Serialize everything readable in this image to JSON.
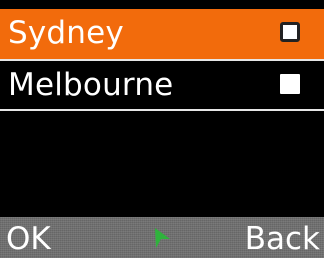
{
  "city_list": {
    "items": [
      {
        "label": "Sydney",
        "selected": true,
        "checked": false
      },
      {
        "label": "Melbourne",
        "selected": false,
        "checked": false
      }
    ],
    "highlight_color": "#f26b0c"
  },
  "softkeys": {
    "left_label": "OK",
    "center_icon": "navigation-arrow-icon",
    "center_icon_color": "#2fb33c",
    "right_label": "Back"
  }
}
